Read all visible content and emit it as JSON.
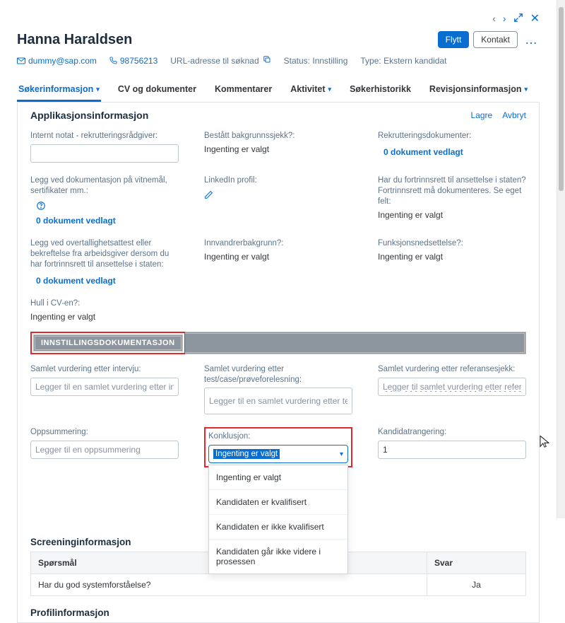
{
  "header": {
    "name": "Hanna Haraldsen",
    "email": "dummy@sap.com",
    "phone": "98756213",
    "appUrlLabel": "URL-adresse til søknad",
    "statusLabel": "Status:",
    "statusValue": "Innstilling",
    "typeLabel": "Type:",
    "typeValue": "Ekstern kandidat",
    "btnMove": "Flytt",
    "btnContact": "Kontakt"
  },
  "tabs": {
    "t0": "Søkerinformasjon",
    "t1": "CV og dokumenter",
    "t2": "Kommentarer",
    "t3": "Aktivitet",
    "t4": "Søkerhistorikk",
    "t5": "Revisjonsinformasjon"
  },
  "panel": {
    "title": "Applikasjonsinformasjon",
    "save": "Lagre",
    "cancel": "Avbryt"
  },
  "fields": {
    "internalNoteLabel": "Internt notat - rekrutteringsrådgiver:",
    "bgCheckLabel": "Bestått bakgrunnssjekk?:",
    "bgCheckValue": "Ingenting er valgt",
    "recruitDocsLabel": "Rekrutteringsdokumenter:",
    "zeroDocs": "0 dokument vedlagt",
    "attachDocsLabel": "Legg ved dokumentasjon på vitnemål, sertifikater mm.:",
    "linkedinLabel": "LinkedIn profil:",
    "priorityLabel": "Har du fortrinnsrett til ansettelse i staten? Fortrinnsrett må dokumenteres. Se eget felt:",
    "priorityValue": "Ingenting er valgt",
    "surplusLabel": "Legg ved overtallighetsattest eller bekreftelse fra arbeidsgiver dersom du har fortrinnsrett til ansettelse i staten:",
    "immigrantLabel": "Innvandrerbakgrunn?:",
    "immigrantValue": "Ingenting er valgt",
    "disabilityLabel": "Funksjonsnedsettelse?:",
    "disabilityValue": "Ingenting er valgt",
    "cvGapLabel": "Hull i CV-en?:",
    "cvGapValue": "Ingenting er valgt"
  },
  "sectionBanner": "INNSTILLINGSDOKUMENTASJON",
  "assess": {
    "interviewLabel": "Samlet vurdering etter intervju:",
    "interviewPh": "Legger til en samlet vurdering etter intervju",
    "testLabel": "Samlet vurdering etter test/case/prøveforelesning:",
    "testPh": "Legger til en samlet vurdering etter test/case/prøveforelesning",
    "refLabel": "Samlet vurdering etter referansesjekk:",
    "refPh": "Legger til samlet vurdering etter referansesjekk",
    "summaryLabel": "Oppsummering:",
    "summaryPh": "Legger til en oppsummering",
    "conclusionLabel": "Konklusjon:",
    "conclusionSel": "Ingenting er valgt",
    "opt0": "Ingenting er valgt",
    "opt1": "Kandidaten er kvalifisert",
    "opt2": "Kandidaten er ikke kvalifisert",
    "opt3": "Kandidaten går ikke videre i prosessen",
    "rankLabel": "Kandidatrangering:",
    "rankValue": "1"
  },
  "screening": {
    "title": "Screeninginformasjon",
    "colQ": "Spørsmål",
    "colA": "Svar",
    "q0": "Har du god systemforståelse?",
    "a0": "Ja"
  },
  "profile": {
    "title": "Profilinformasjon"
  }
}
